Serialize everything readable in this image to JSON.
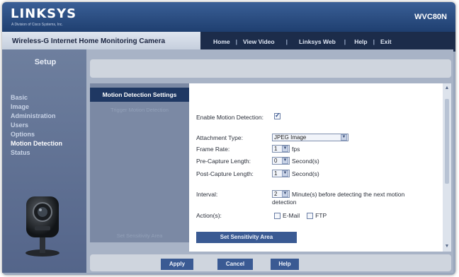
{
  "header": {
    "logo": "LINKSYS",
    "logo_sub": "A Division of Cisco Systems, Inc.",
    "model": "WVC80N"
  },
  "navbar": {
    "product_title": "Wireless-G Internet Home Monitoring Camera",
    "links": [
      "Home",
      "View Video",
      "Linksys Web",
      "Help",
      "Exit"
    ]
  },
  "sidebar": {
    "heading": "Setup",
    "items": [
      "Basic",
      "Image",
      "Administration",
      "Users",
      "Options",
      "Motion Detection",
      "Status"
    ],
    "active": "Motion Detection"
  },
  "section": {
    "title": "Motion Detection Settings",
    "sub_ghost": "Trigger Motion Detection",
    "bottom_ghost": "Set Sensitivity Area"
  },
  "form": {
    "enable_label": "Enable Motion Detection:",
    "enable_checked": true,
    "attachment_label": "Attachment Type:",
    "attachment_value": "JPEG Image",
    "frame_rate_label": "Frame Rate:",
    "frame_rate_value": "1",
    "frame_rate_unit": "fps",
    "pre_capture_label": "Pre-Capture Length:",
    "pre_capture_value": "0",
    "pre_capture_unit": "Second(s)",
    "post_capture_label": "Post-Capture Length:",
    "post_capture_value": "1",
    "post_capture_unit": "Second(s)",
    "interval_label": "Interval:",
    "interval_value": "2",
    "interval_unit_line1": "Minute(s) before detecting the next motion",
    "interval_unit_line2": "detection",
    "actions_label": "Action(s):",
    "action_email": "E-Mail",
    "action_ftp": "FTP",
    "email_checked": false,
    "ftp_checked": false
  },
  "buttons": {
    "set_sensitivity": "Set Sensitivity Area",
    "apply": "Apply",
    "cancel": "Cancel",
    "help": "Help"
  }
}
